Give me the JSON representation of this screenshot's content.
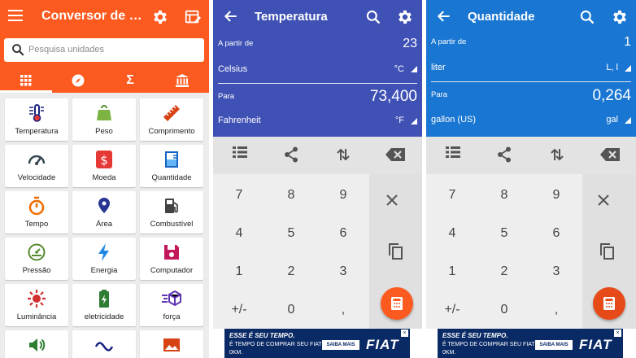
{
  "colors": {
    "orange": "#fc5a1f",
    "indigo": "#3f51b5",
    "blue": "#1976d2",
    "fab_dark": "#e64a19"
  },
  "categories_screen": {
    "title": "Conversor de unidades",
    "search_placeholder": "Pesquisa unidades",
    "tabs": [
      {
        "icon": "grid-icon",
        "active": true
      },
      {
        "icon": "compass-icon",
        "active": false
      },
      {
        "icon": "sigma-icon",
        "label": "Σ",
        "active": false
      },
      {
        "icon": "bank-icon",
        "active": false
      }
    ],
    "tiles": [
      {
        "label": "Temperatura",
        "icon": "thermometer-icon"
      },
      {
        "label": "Peso",
        "icon": "weight-icon"
      },
      {
        "label": "Comprimento",
        "icon": "ruler-icon"
      },
      {
        "label": "Velocidade",
        "icon": "speedometer-icon"
      },
      {
        "label": "Moeda",
        "icon": "currency-icon"
      },
      {
        "label": "Quantidade",
        "icon": "beaker-icon"
      },
      {
        "label": "Tempo",
        "icon": "stopwatch-icon"
      },
      {
        "label": "Área",
        "icon": "map-pin-icon"
      },
      {
        "label": "Combustível",
        "icon": "fuel-icon"
      },
      {
        "label": "Pressão",
        "icon": "gauge-icon"
      },
      {
        "label": "Energia",
        "icon": "lightning-icon"
      },
      {
        "label": "Computador",
        "icon": "floppy-icon"
      },
      {
        "label": "Luminância",
        "icon": "sun-icon"
      },
      {
        "label": "eletricidade",
        "icon": "battery-icon"
      },
      {
        "label": "força",
        "icon": "cube-force-icon"
      },
      {
        "label": "",
        "icon": "speaker-icon"
      },
      {
        "label": "",
        "icon": "wave-icon"
      },
      {
        "label": "",
        "icon": "image-icon"
      }
    ]
  },
  "temperature_screen": {
    "title": "Temperatura",
    "from_label": "A partir de",
    "from_value": "23",
    "from_unit": "Celsius",
    "from_symbol": "°C",
    "to_label": "Para",
    "to_value": "73,400",
    "to_unit": "Fahrenheit",
    "to_symbol": "°F"
  },
  "quantity_screen": {
    "title": "Quantidade",
    "from_label": "A partir de",
    "from_value": "1",
    "from_unit": "liter",
    "from_symbol": "L, l",
    "to_label": "Para",
    "to_value": "0,264",
    "to_unit": "gallon (US)",
    "to_symbol": "gal"
  },
  "keypad": {
    "keys": [
      "7",
      "8",
      "9",
      "4",
      "5",
      "6",
      "1",
      "2",
      "3",
      "+/-",
      "0",
      ","
    ]
  },
  "ad": {
    "line1": "ESSE É SEU TEMPO.",
    "line2": "É TEMPO DE COMPRAR SEU FIAT",
    "line3": "0KM.",
    "cta": "SAIBA MAIS",
    "brand": "FIAT"
  }
}
